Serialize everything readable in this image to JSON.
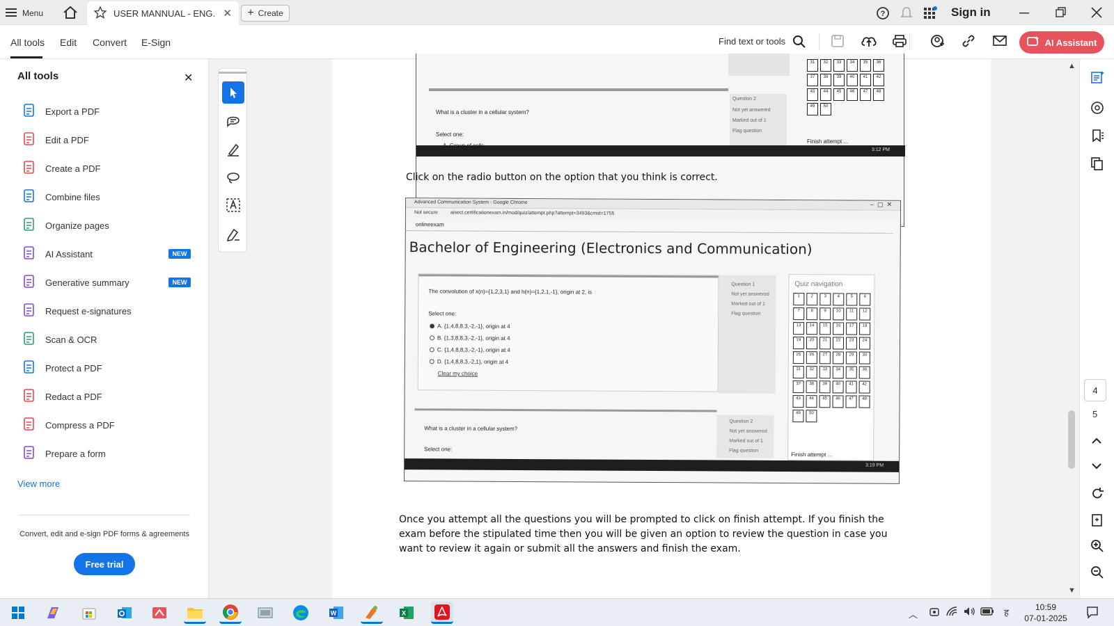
{
  "titlebar": {
    "menu_label": "Menu",
    "tab_title": "USER MANNUAL - ENG...",
    "create_label": "Create",
    "signin_label": "Sign in"
  },
  "toolbar": {
    "tabs": [
      "All tools",
      "Edit",
      "Convert",
      "E-Sign"
    ],
    "find_label": "Find text or tools",
    "ai_label": "AI Assistant"
  },
  "panel": {
    "title": "All tools",
    "items": [
      {
        "label": "Export a PDF",
        "icon": "export-pdf-icon",
        "color": "#1473e6"
      },
      {
        "label": "Edit a PDF",
        "icon": "edit-pdf-icon",
        "color": "#e34850"
      },
      {
        "label": "Create a PDF",
        "icon": "create-pdf-icon",
        "color": "#e34850"
      },
      {
        "label": "Combine files",
        "icon": "combine-files-icon",
        "color": "#1473e6"
      },
      {
        "label": "Organize pages",
        "icon": "organize-pages-icon",
        "color": "#2d9d78"
      },
      {
        "label": "AI Assistant",
        "icon": "ai-assistant-icon",
        "color": "#7e4cd4",
        "badge": "NEW"
      },
      {
        "label": "Generative summary",
        "icon": "generative-summary-icon",
        "color": "#7e4cd4",
        "badge": "NEW"
      },
      {
        "label": "Request e-signatures",
        "icon": "request-esign-icon",
        "color": "#7e4cd4"
      },
      {
        "label": "Scan & OCR",
        "icon": "scan-ocr-icon",
        "color": "#2d9d78"
      },
      {
        "label": "Protect a PDF",
        "icon": "protect-pdf-icon",
        "color": "#1473e6"
      },
      {
        "label": "Redact a PDF",
        "icon": "redact-pdf-icon",
        "color": "#e34850"
      },
      {
        "label": "Compress a PDF",
        "icon": "compress-pdf-icon",
        "color": "#e34850"
      },
      {
        "label": "Prepare a form",
        "icon": "prepare-form-icon",
        "color": "#7e4cd4"
      }
    ],
    "view_more": "View more",
    "promo": "Convert, edit and e-sign PDF forms & agreements",
    "trial_label": "Free trial"
  },
  "document": {
    "shot1": {
      "question2_title": "What is a cluster in a cellular system?",
      "select_one": "Select one:",
      "option_a": "A. Group of cells",
      "q_label": "Question 2",
      "q_status": "Not yet answered",
      "q_marks": "Marked out of 1",
      "q_flag": "Flag question",
      "finish": "Finish attempt ...",
      "clock": "3:12 PM",
      "nav_numbers": [
        "31",
        "32",
        "33",
        "34",
        "35",
        "36",
        "37",
        "38",
        "39",
        "40",
        "41",
        "42",
        "43",
        "44",
        "45",
        "46",
        "47",
        "48",
        "49",
        "50"
      ]
    },
    "instruction_1": "Click on the radio button on the option that you think is correct.",
    "shot2": {
      "window_title": "Advanced Communication System - Google Chrome",
      "not_secure": "Not secure",
      "url": "aisect.certificationexam.in/mod/quiz/attempt.php?attempt=3493&cmid=1755",
      "site_label": "onlineexam",
      "heading": "Bachelor of Engineering (Electronics and Communication)",
      "question1": "The convolution of x(n)={1,2,3,1} and h(n)={1,2,1,-1}, origin at 2, is",
      "select_one": "Select one:",
      "options": [
        "A. {1,4,8,8,3,-2,-1}, origin at 4",
        "B. {1,3,8,8,3,-2,-1}, origin at 4",
        "C. {1,4,8,8,3,-2,-1}, origin at 4",
        "D. {1,4,8,8,3,-2,1}, origin at 4"
      ],
      "clear_choice": "Clear my choice",
      "q1_label": "Question 1",
      "q1_status": "Not yet answered",
      "q1_marks": "Marked out of 1",
      "q1_flag": "Flag question",
      "nav_title": "Quiz navigation",
      "question2": "What is a cluster in a cellular system?",
      "select_one_2": "Select one:",
      "q2_label": "Question 2",
      "q2_status": "Not yet answered",
      "q2_marks": "Marked out of 1",
      "q2_flag": "Flag question",
      "finish": "Finish attempt ...",
      "clock": "3:19 PM",
      "nav_numbers": [
        "1",
        "2",
        "3",
        "4",
        "5",
        "6",
        "7",
        "8",
        "9",
        "10",
        "11",
        "12",
        "13",
        "14",
        "15",
        "16",
        "17",
        "18",
        "19",
        "20",
        "21",
        "22",
        "23",
        "24",
        "25",
        "26",
        "27",
        "28",
        "29",
        "30",
        "31",
        "32",
        "33",
        "34",
        "35",
        "36",
        "37",
        "38",
        "39",
        "40",
        "41",
        "42",
        "43",
        "44",
        "45",
        "46",
        "47",
        "48",
        "49",
        "50"
      ]
    },
    "instruction_2": "Once you attempt all the questions you will be prompted to click on finish attempt. If you finish the exam before the stipulated time then you will be given an option to review the question in case you want to review it again or submit all the answers and finish the exam."
  },
  "page_nav": {
    "current": "4",
    "next": "5"
  },
  "taskbar": {
    "time": "10:59",
    "date": "07-01-2025"
  }
}
